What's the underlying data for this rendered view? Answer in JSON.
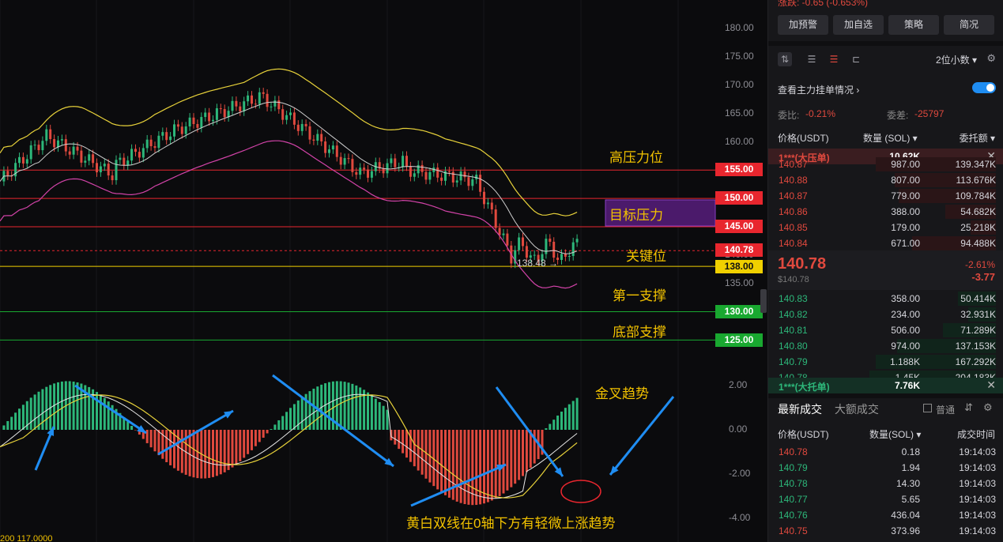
{
  "chart": {
    "price_axis": [
      "180.00",
      "175.00",
      "170.00",
      "165.00",
      "160.00",
      "155.00",
      "150.00",
      "145.00",
      "140.00",
      "135.00"
    ],
    "macd_axis": [
      "2.00",
      "0.00",
      "-2.00",
      "-4.00"
    ],
    "price_tags": [
      {
        "label": "155.00",
        "color": "#e8262e"
      },
      {
        "label": "150.00",
        "color": "#e8262e"
      },
      {
        "label": "145.00",
        "color": "#e8262e"
      },
      {
        "label": "140.78",
        "color": "#e8262e"
      },
      {
        "label": "138.00",
        "color": "#f0d000"
      },
      {
        "label": "130.00",
        "color": "#19a830"
      },
      {
        "label": "125.00",
        "color": "#19a830"
      }
    ],
    "low_marker": "138.48",
    "annotations": {
      "resistance_high": "高压力位",
      "target_resistance": "目标压力",
      "key_level": "关键位",
      "support_first": "第一支撑",
      "support_bottom": "底部支撑",
      "golden_cross": "金叉趋势",
      "macd_note": "黄白双线在0轴下方有轻微上涨趋势"
    },
    "bottom_left_fragment": "200 117.0000",
    "colors": {
      "up": "#2db77a",
      "down": "#e0493e",
      "boll_upper": "#e8d23a",
      "boll_mid": "#cfcfcf",
      "boll_lower": "#d243a8",
      "arrow": "#1f8df2"
    }
  },
  "panel": {
    "top_strip": "涨跌: -0.65 (-0.653%)",
    "buttons": [
      "加预警",
      "加自选",
      "策略",
      "简况"
    ],
    "decimal_select": "2位小数",
    "main_orders_link": "查看主力挂单情况",
    "ratio_label": "委比:",
    "ratio_value": "-0.21%",
    "diff_label": "委差:",
    "diff_value": "-25797",
    "ob_headers": {
      "price": "价格(USDT)",
      "qty": "数量 (SOL)",
      "total": "委托额"
    },
    "big_ask": {
      "label": "1***(大压单)",
      "value": "10.62K"
    },
    "asks": [
      {
        "p": "140.87",
        "q": "987.00",
        "t": "139.347K",
        "w": 0.95
      },
      {
        "p": "140.88",
        "q": "807.00",
        "t": "113.676K",
        "w": 0.8
      },
      {
        "p": "140.87",
        "q": "779.00",
        "t": "109.784K",
        "w": 0.77
      },
      {
        "p": "140.86",
        "q": "388.00",
        "t": "54.682K",
        "w": 0.4
      },
      {
        "p": "140.85",
        "q": "179.00",
        "t": "25.218K",
        "w": 0.2
      },
      {
        "p": "140.84",
        "q": "671.00",
        "t": "94.488K",
        "w": 0.66
      }
    ],
    "mid": {
      "price": "140.78",
      "sub": "$140.78",
      "pct": "-2.61%",
      "chg": "-3.77"
    },
    "bids": [
      {
        "p": "140.83",
        "q": "358.00",
        "t": "50.414K",
        "w": 0.3
      },
      {
        "p": "140.82",
        "q": "234.00",
        "t": "32.931K",
        "w": 0.22
      },
      {
        "p": "140.81",
        "q": "506.00",
        "t": "71.289K",
        "w": 0.42
      },
      {
        "p": "140.80",
        "q": "974.00",
        "t": "137.153K",
        "w": 0.78
      },
      {
        "p": "140.79",
        "q": "1.188K",
        "t": "167.292K",
        "w": 0.95
      },
      {
        "p": "140.78",
        "q": "1.45K",
        "t": "204.183K",
        "w": 1.0
      }
    ],
    "big_bid": {
      "label": "1***(大托单)",
      "value": "7.76K"
    },
    "trade_tabs": [
      "最新成交",
      "大额成交"
    ],
    "normal_check": "普通",
    "trade_headers": {
      "price": "价格(USDT)",
      "qty": "数量(SOL)",
      "time": "成交时间"
    },
    "trades": [
      {
        "p": "140.78",
        "q": "0.18",
        "t": "19:14:03",
        "side": "down"
      },
      {
        "p": "140.79",
        "q": "1.94",
        "t": "19:14:03",
        "side": "up"
      },
      {
        "p": "140.78",
        "q": "14.30",
        "t": "19:14:03",
        "side": "up"
      },
      {
        "p": "140.77",
        "q": "5.65",
        "t": "19:14:03",
        "side": "up"
      },
      {
        "p": "140.76",
        "q": "436.04",
        "t": "19:14:03",
        "side": "up"
      },
      {
        "p": "140.75",
        "q": "373.96",
        "t": "19:14:03",
        "side": "down"
      }
    ]
  }
}
